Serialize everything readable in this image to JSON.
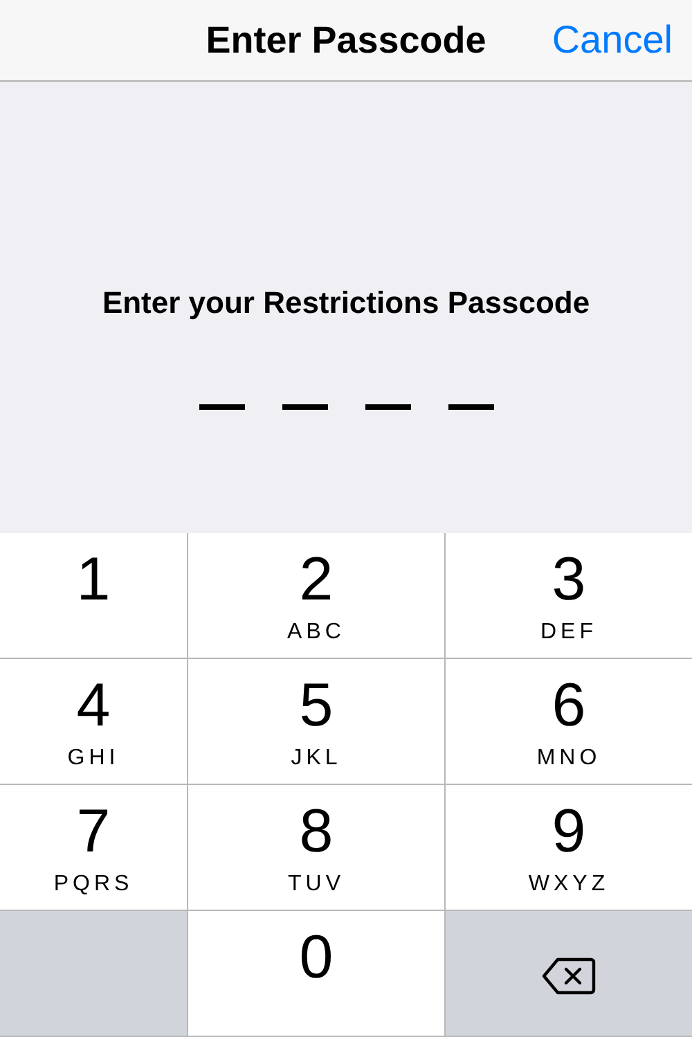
{
  "nav_bar": {
    "title": "Enter Passcode",
    "cancel": "Cancel"
  },
  "prompt": "Enter your Restrictions Passcode",
  "passcode_slots": [
    {
      "filled": false
    },
    {
      "filled": false
    },
    {
      "filled": false
    },
    {
      "filled": false
    }
  ],
  "keypad": [
    {
      "kind": "digit",
      "digit": "1"
    },
    {
      "kind": "digit",
      "digit": "2",
      "letters": "ABC"
    },
    {
      "kind": "digit",
      "digit": "3",
      "letters": "DEF"
    },
    {
      "kind": "digit",
      "digit": "4",
      "letters": "GHI"
    },
    {
      "kind": "digit",
      "digit": "5",
      "letters": "JKL"
    },
    {
      "kind": "digit",
      "digit": "6",
      "letters": "MNO"
    },
    {
      "kind": "digit",
      "digit": "7",
      "letters": "PQRS"
    },
    {
      "kind": "digit",
      "digit": "8",
      "letters": "TUV"
    },
    {
      "kind": "digit",
      "digit": "9",
      "letters": "WXYZ"
    },
    {
      "kind": "blank"
    },
    {
      "kind": "digit",
      "digit": "0"
    },
    {
      "kind": "delete"
    }
  ]
}
